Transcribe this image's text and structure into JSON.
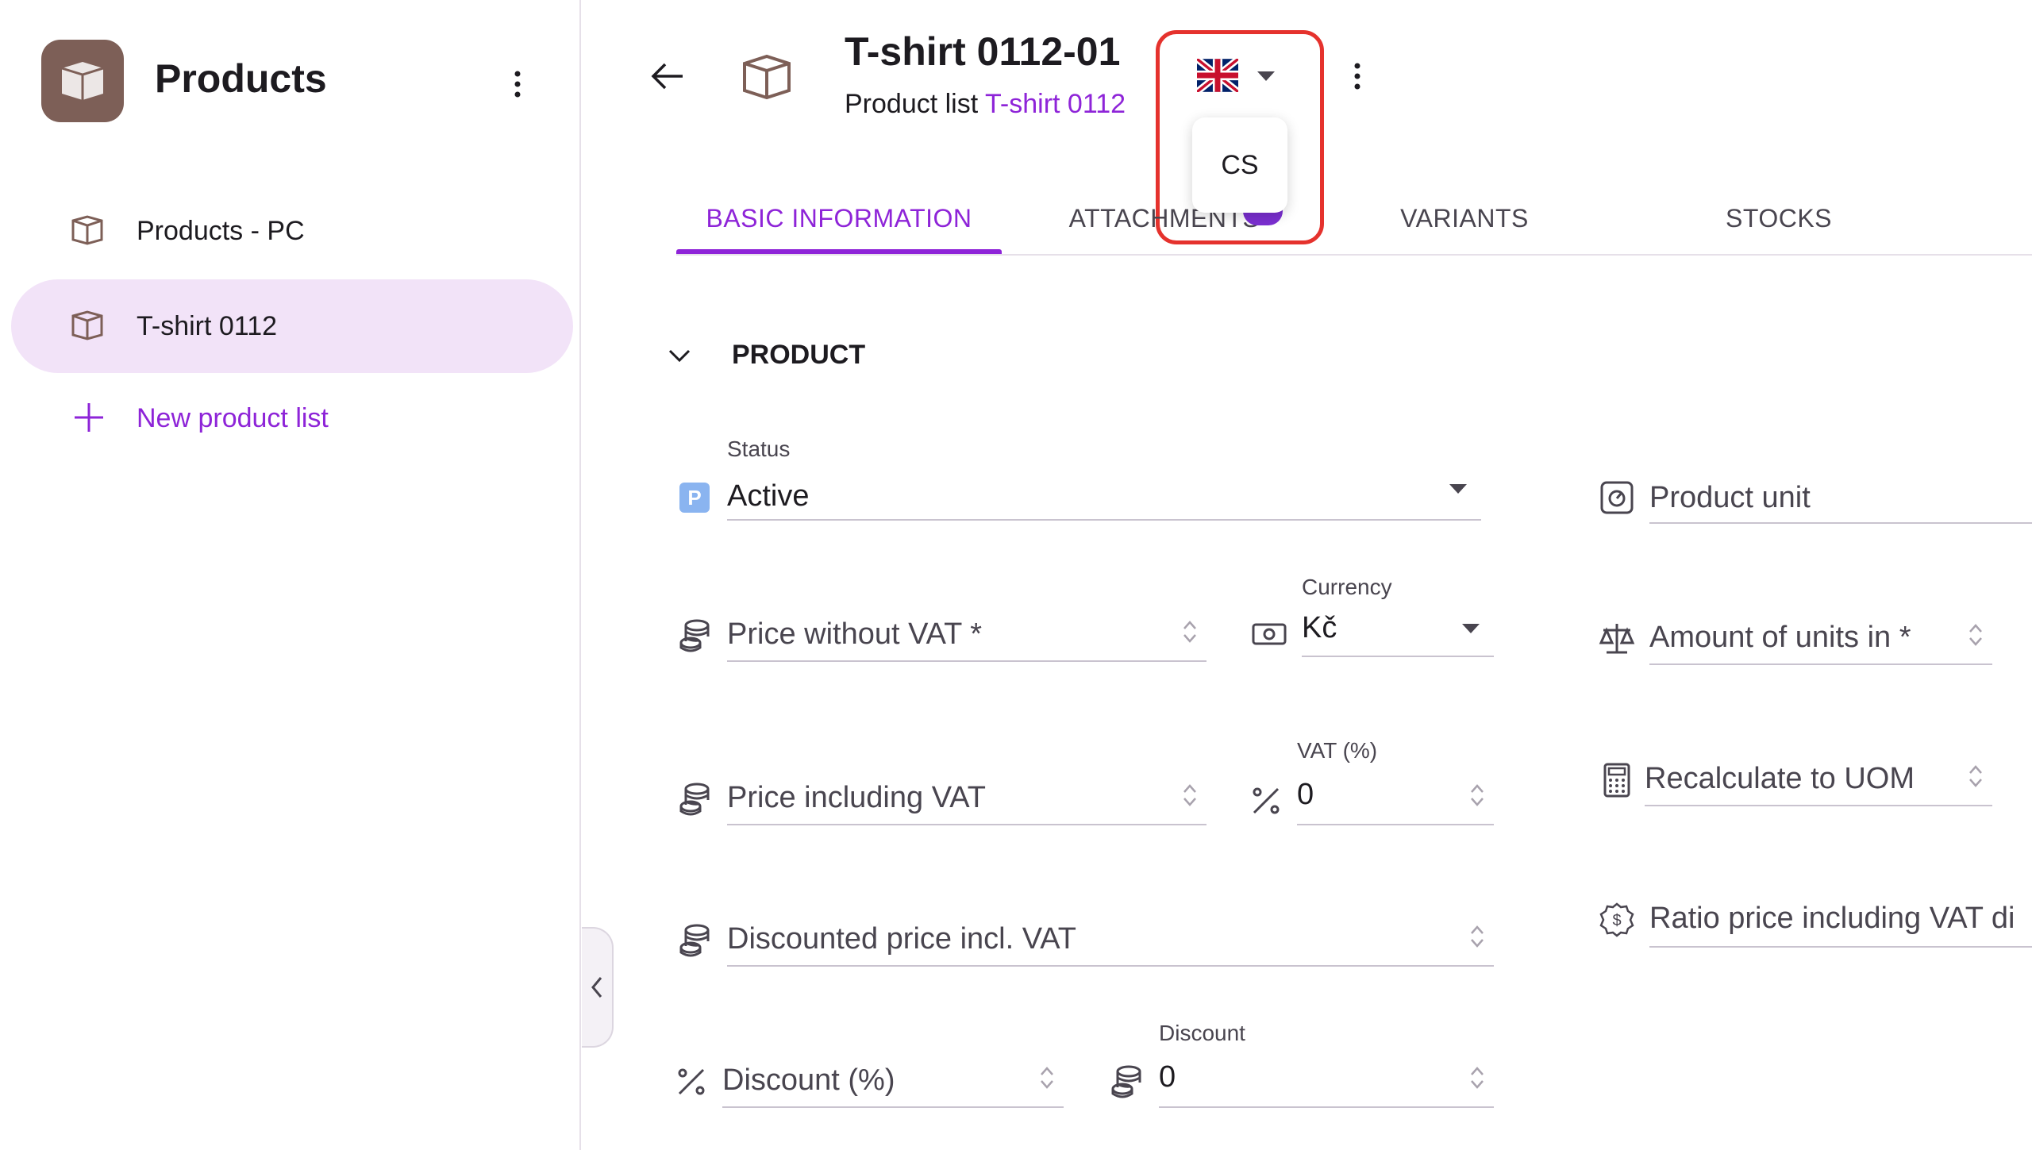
{
  "sidebar": {
    "title": "Products",
    "items": [
      {
        "label": "Products - PC",
        "active": false
      },
      {
        "label": "T-shirt 0112",
        "active": true
      }
    ],
    "new_list_label": "New product list"
  },
  "header": {
    "title": "T-shirt 0112-01",
    "subtitle_prefix": "Product list",
    "subtitle_link": "T-shirt 0112",
    "language_option": "CS"
  },
  "tabs": [
    {
      "label": "BASIC INFORMATION",
      "active": true
    },
    {
      "label": "ATTACHMENTS",
      "active": false
    },
    {
      "label": "VARIANTS",
      "active": false
    },
    {
      "label": "STOCKS",
      "active": false
    }
  ],
  "section": {
    "title": "PRODUCT"
  },
  "fields": {
    "status_label": "Status",
    "status_badge": "P",
    "status_value": "Active",
    "product_unit": "Product unit",
    "price_without_vat": "Price without VAT *",
    "currency_label": "Currency",
    "currency_value": "Kč",
    "amount_of_units": "Amount of units in *",
    "price_including_vat": "Price including VAT",
    "vat_label": "VAT (%)",
    "vat_value": "0",
    "recalculate_uom": "Recalculate to UOM",
    "discounted_price": "Discounted price incl. VAT",
    "ratio_price": "Ratio price including VAT di",
    "discount_percent": "Discount (%)",
    "discount_label": "Discount",
    "discount_value": "0"
  },
  "colors": {
    "accent": "#8e24d8",
    "active_item_bg": "#f2e3f8",
    "highlight_border": "#e5322d",
    "logo_bg": "#7d5f57"
  }
}
